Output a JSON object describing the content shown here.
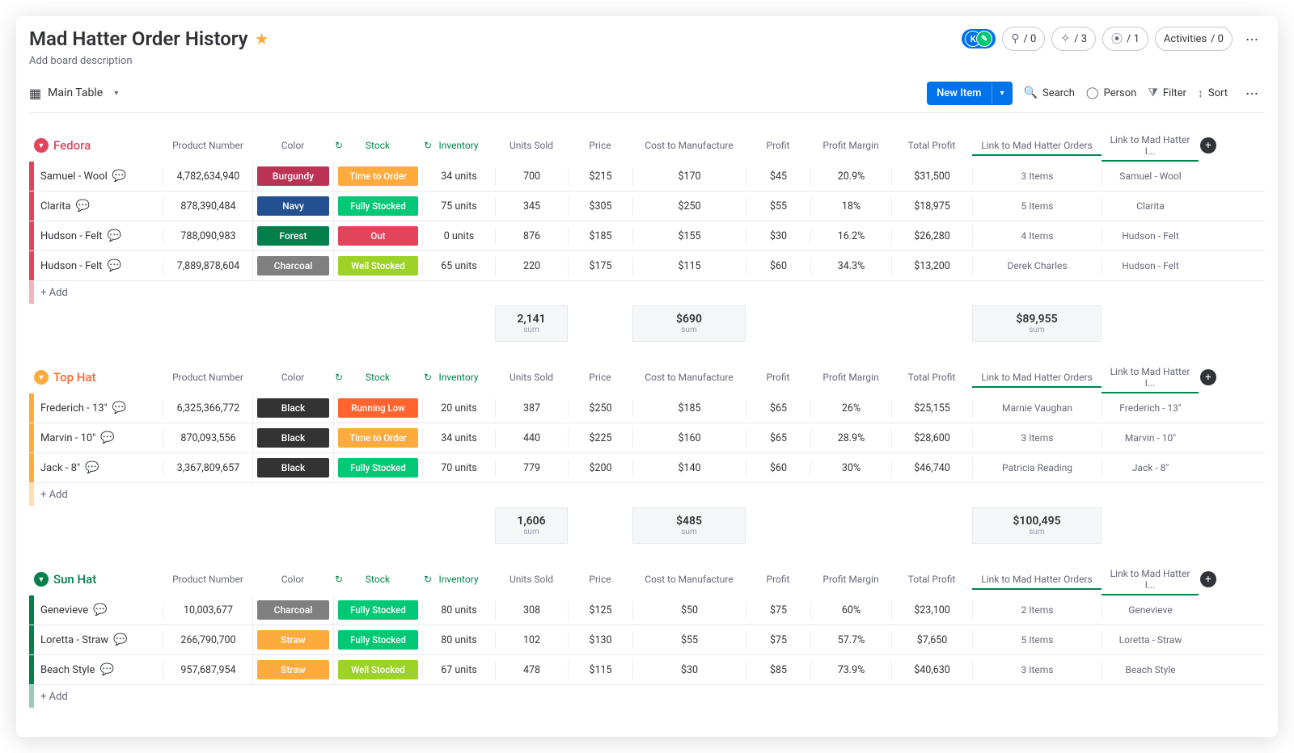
{
  "board": {
    "title": "Mad Hatter Order History",
    "description": "Add board description",
    "view_name": "Main Table"
  },
  "header_pills": {
    "avatar_letter": "K",
    "plug_count": "/ 0",
    "like_count": "/ 3",
    "members_count": "/ 1",
    "activities_label": "Activities",
    "activities_count": "/ 0"
  },
  "toolbar": {
    "new_item_label": "New Item",
    "search_label": "Search",
    "person_label": "Person",
    "filter_label": "Filter",
    "sort_label": "Sort"
  },
  "columns": [
    "Product Number",
    "Color",
    "Stock",
    "Inventory",
    "Units Sold",
    "Price",
    "Cost to Manufacture",
    "Profit",
    "Profit Margin",
    "Total Profit",
    "Link to Mad Hatter Orders",
    "Link to Mad Hatter I..."
  ],
  "add_row_label": "+ Add",
  "sum_label": "sum",
  "groups": [
    {
      "name": "Fedora",
      "color_class": "grp-fedora",
      "stripe_class": "bg-fedora",
      "rows": [
        {
          "name": "Samuel - Wool",
          "product_number": "4,782,634,940",
          "color": "Burgundy",
          "color_class": "c-burgundy",
          "stock": "Time to Order",
          "stock_class": "s-time-to-order",
          "inventory": "34 units",
          "units_sold": "700",
          "price": "$215",
          "cost": "$170",
          "profit": "$45",
          "margin": "20.9%",
          "total_profit": "$31,500",
          "link_a": "3 Items",
          "link_b": "Samuel - Wool"
        },
        {
          "name": "Clarita",
          "product_number": "878,390,484",
          "color": "Navy",
          "color_class": "c-navy",
          "stock": "Fully Stocked",
          "stock_class": "s-fully-stocked",
          "inventory": "75 units",
          "units_sold": "345",
          "price": "$305",
          "cost": "$250",
          "profit": "$55",
          "margin": "18%",
          "total_profit": "$18,975",
          "link_a": "5 Items",
          "link_b": "Clarita"
        },
        {
          "name": "Hudson - Felt",
          "product_number": "788,090,983",
          "color": "Forest",
          "color_class": "c-forest",
          "stock": "Out",
          "stock_class": "s-out",
          "inventory": "0 units",
          "units_sold": "876",
          "price": "$185",
          "cost": "$155",
          "profit": "$30",
          "margin": "16.2%",
          "total_profit": "$26,280",
          "link_a": "4 Items",
          "link_b": "Hudson - Felt"
        },
        {
          "name": "Hudson - Felt",
          "product_number": "7,889,878,604",
          "color": "Charcoal",
          "color_class": "c-charcoal",
          "stock": "Well Stocked",
          "stock_class": "s-well-stocked",
          "inventory": "65 units",
          "units_sold": "220",
          "price": "$175",
          "cost": "$115",
          "profit": "$60",
          "margin": "34.3%",
          "total_profit": "$13,200",
          "link_a": "Derek Charles",
          "link_b": "Hudson - Felt"
        }
      ],
      "summary": {
        "units_sold": "2,141",
        "cost": "$690",
        "total_profit": "$89,955"
      }
    },
    {
      "name": "Top Hat",
      "color_class": "grp-tophat",
      "stripe_class": "bg-tophat",
      "rows": [
        {
          "name": "Frederich - 13\"",
          "product_number": "6,325,366,772",
          "color": "Black",
          "color_class": "c-black",
          "stock": "Running Low",
          "stock_class": "s-running-low",
          "inventory": "20 units",
          "units_sold": "387",
          "price": "$250",
          "cost": "$185",
          "profit": "$65",
          "margin": "26%",
          "total_profit": "$25,155",
          "link_a": "Marnie Vaughan",
          "link_b": "Frederich - 13\""
        },
        {
          "name": "Marvin - 10\"",
          "product_number": "870,093,556",
          "color": "Black",
          "color_class": "c-black",
          "stock": "Time to Order",
          "stock_class": "s-time-to-order",
          "inventory": "34 units",
          "units_sold": "440",
          "price": "$225",
          "cost": "$160",
          "profit": "$65",
          "margin": "28.9%",
          "total_profit": "$28,600",
          "link_a": "3 Items",
          "link_b": "Marvin - 10\""
        },
        {
          "name": "Jack - 8\"",
          "product_number": "3,367,809,657",
          "color": "Black",
          "color_class": "c-black",
          "stock": "Fully Stocked",
          "stock_class": "s-fully-stocked",
          "inventory": "70 units",
          "units_sold": "779",
          "price": "$200",
          "cost": "$140",
          "profit": "$60",
          "margin": "30%",
          "total_profit": "$46,740",
          "link_a": "Patricia Reading",
          "link_b": "Jack - 8\""
        }
      ],
      "summary": {
        "units_sold": "1,606",
        "cost": "$485",
        "total_profit": "$100,495"
      }
    },
    {
      "name": "Sun Hat",
      "color_class": "grp-sunhat",
      "stripe_class": "bg-sunhat",
      "rows": [
        {
          "name": "Genevieve",
          "product_number": "10,003,677",
          "color": "Charcoal",
          "color_class": "c-charcoal",
          "stock": "Fully Stocked",
          "stock_class": "s-fully-stocked",
          "inventory": "80 units",
          "units_sold": "308",
          "price": "$125",
          "cost": "$50",
          "profit": "$75",
          "margin": "60%",
          "total_profit": "$23,100",
          "link_a": "2 Items",
          "link_b": "Genevieve"
        },
        {
          "name": "Loretta - Straw",
          "product_number": "266,790,700",
          "color": "Straw",
          "color_class": "c-straw",
          "stock": "Fully Stocked",
          "stock_class": "s-fully-stocked",
          "inventory": "80 units",
          "units_sold": "102",
          "price": "$130",
          "cost": "$55",
          "profit": "$75",
          "margin": "57.7%",
          "total_profit": "$7,650",
          "link_a": "5 Items",
          "link_b": "Loretta - Straw"
        },
        {
          "name": "Beach Style",
          "product_number": "957,687,954",
          "color": "Straw",
          "color_class": "c-straw",
          "stock": "Well Stocked",
          "stock_class": "s-well-stocked",
          "inventory": "67 units",
          "units_sold": "478",
          "price": "$115",
          "cost": "$30",
          "profit": "$85",
          "margin": "73.9%",
          "total_profit": "$40,630",
          "link_a": "3 Items",
          "link_b": "Beach Style"
        }
      ],
      "summary": null
    }
  ]
}
